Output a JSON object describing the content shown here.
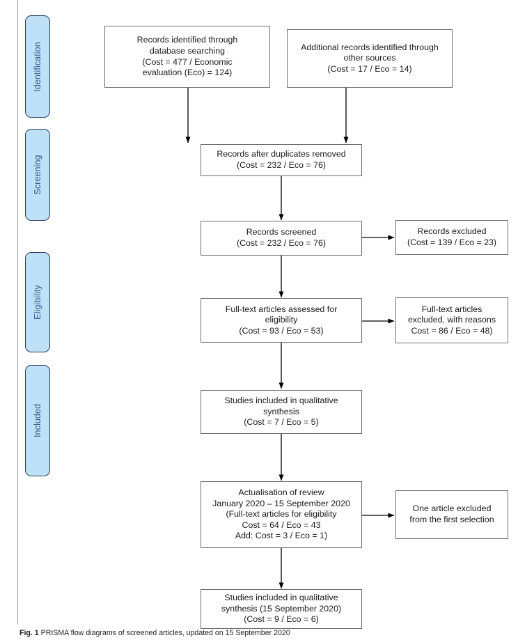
{
  "figure": {
    "caption_label": "Fig. 1",
    "caption_text": "PRISMA flow diagrams of screened articles, updated on 15 September 2020"
  },
  "colors": {
    "pill_fill": "#bfe1f7",
    "pill_border": "#23395f",
    "pill_text": "#2d5a8e",
    "box_border": "#6e6e6e",
    "box_text": "#1a1a1a",
    "arrow": "#000000",
    "rule": "#9a9a9a"
  },
  "stages": [
    {
      "label": "Identification"
    },
    {
      "label": "Screening"
    },
    {
      "label": "Eligibility"
    },
    {
      "label": "Included"
    }
  ],
  "boxes": {
    "database_search": "Records identified through\ndatabase searching\n(Cost = 477 / Economic\nevaluation (Eco) = 124)",
    "other_sources": "Additional records identified through\nother sources\n(Cost = 17 / Eco = 14)",
    "duplicates_removed": "Records after duplicates removed\n(Cost = 232 / Eco = 76)",
    "records_screened": "Records screened\n(Cost = 232 / Eco = 76)",
    "records_excluded": "Records excluded\n(Cost = 139 / Eco = 23)",
    "fulltext_assessed": "Full-text articles assessed for\neligibility\n(Cost = 93 / Eco = 53)",
    "fulltext_excluded": "Full-text articles\nexcluded, with reasons\nCost = 86 / Eco = 48)",
    "qualitative_synthesis": "Studies included in qualitative\nsynthesis\n(Cost = 7 / Eco = 5)",
    "actualisation": "Actualisation of review\nJanuary 2020 – 15 September 2020\n(Full-text articles for eligibility\nCost = 64 / Eco = 43\nAdd: Cost = 3 / Eco = 1)",
    "one_article_excluded": "One article excluded\nfrom the first selection",
    "qualitative_synthesis_updated": "Studies included in qualitative\nsynthesis (15 September 2020)\n(Cost = 9 / Eco = 6)"
  },
  "chart_data": {
    "type": "diagram",
    "title": "PRISMA flow diagram of screened articles, updated on 15 September 2020",
    "stage_bands": [
      "Identification",
      "Screening",
      "Eligibility",
      "Included"
    ],
    "nodes": [
      {
        "id": "database_search",
        "stage": "Identification",
        "cost": 477,
        "eco": 124
      },
      {
        "id": "other_sources",
        "stage": "Identification",
        "cost": 17,
        "eco": 14
      },
      {
        "id": "duplicates_removed",
        "stage": "Screening",
        "cost": 232,
        "eco": 76
      },
      {
        "id": "records_screened",
        "stage": "Screening",
        "cost": 232,
        "eco": 76
      },
      {
        "id": "records_excluded",
        "stage": "Screening",
        "cost": 139,
        "eco": 23
      },
      {
        "id": "fulltext_assessed",
        "stage": "Eligibility",
        "cost": 93,
        "eco": 53
      },
      {
        "id": "fulltext_excluded",
        "stage": "Eligibility",
        "cost": 86,
        "eco": 48
      },
      {
        "id": "qualitative_synthesis",
        "stage": "Included",
        "cost": 7,
        "eco": 5
      },
      {
        "id": "actualisation",
        "stage": "Included",
        "cost": 64,
        "eco": 43,
        "added_cost": 3,
        "added_eco": 1
      },
      {
        "id": "one_article_excluded",
        "stage": "Included",
        "count": 1
      },
      {
        "id": "qualitative_synthesis_updated",
        "stage": "Included",
        "cost": 9,
        "eco": 6
      }
    ],
    "edges": [
      {
        "from": "database_search",
        "to": "duplicates_removed"
      },
      {
        "from": "other_sources",
        "to": "duplicates_removed"
      },
      {
        "from": "duplicates_removed",
        "to": "records_screened"
      },
      {
        "from": "records_screened",
        "to": "records_excluded"
      },
      {
        "from": "records_screened",
        "to": "fulltext_assessed"
      },
      {
        "from": "fulltext_assessed",
        "to": "fulltext_excluded"
      },
      {
        "from": "fulltext_assessed",
        "to": "qualitative_synthesis"
      },
      {
        "from": "qualitative_synthesis",
        "to": "actualisation"
      },
      {
        "from": "actualisation",
        "to": "one_article_excluded"
      },
      {
        "from": "actualisation",
        "to": "qualitative_synthesis_updated"
      }
    ]
  }
}
